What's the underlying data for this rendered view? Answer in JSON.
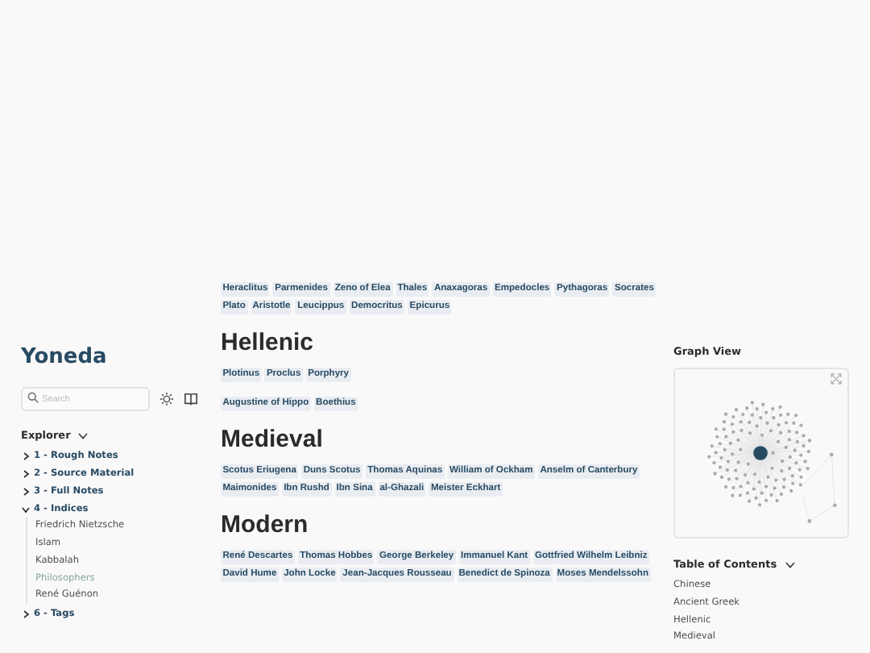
{
  "site_title": "Yoneda",
  "search": {
    "placeholder": "Search"
  },
  "explorer": {
    "title": "Explorer",
    "expanded": true,
    "items": [
      {
        "label": "1 - Rough Notes",
        "expanded": false
      },
      {
        "label": "2 - Source Material",
        "expanded": false
      },
      {
        "label": "3 - Full Notes",
        "expanded": false
      },
      {
        "label": "4 - Indices",
        "expanded": true,
        "children": [
          {
            "label": "Friedrich Nietzsche",
            "selected": false
          },
          {
            "label": "Islam",
            "selected": false
          },
          {
            "label": "Kabbalah",
            "selected": false
          },
          {
            "label": "Philosophers",
            "selected": true
          },
          {
            "label": "René Guénon",
            "selected": false
          }
        ]
      },
      {
        "label": "6 - Tags",
        "expanded": false
      }
    ]
  },
  "sections": [
    {
      "tag_groups": [
        [
          "Heraclitus",
          "Parmenides",
          "Zeno of Elea",
          "Thales",
          "Anaxagoras",
          "Empedocles",
          "Pythagoras",
          "Socrates",
          "Plato",
          "Aristotle",
          "Leucippus",
          "Democritus",
          "Epicurus"
        ]
      ]
    },
    {
      "heading": "Hellenic",
      "tag_groups": [
        [
          "Plotinus",
          "Proclus",
          "Porphyry"
        ],
        [
          "Augustine of Hippo",
          "Boethius"
        ]
      ]
    },
    {
      "heading": "Medieval",
      "tag_groups": [
        [
          "Scotus Eriugena",
          "Duns Scotus",
          "Thomas Aquinas",
          "William of Ockham",
          "Anselm of Canterbury",
          "Maimonides",
          "Ibn Rushd",
          "Ibn Sina",
          "al-Ghazali",
          "Meister Eckhart"
        ]
      ]
    },
    {
      "heading": "Modern",
      "tag_groups": [
        [
          "René Descartes",
          "Thomas Hobbes",
          "George Berkeley",
          "Immanuel Kant",
          "Gottfried Wilhelm Leibniz",
          "David Hume",
          "John Locke",
          "Jean-Jacques Rousseau",
          "Benedict de Spinoza",
          "Moses Mendelssohn"
        ]
      ]
    }
  ],
  "graph_view": {
    "title": "Graph View"
  },
  "toc": {
    "title": "Table of Contents",
    "expanded": true,
    "items": [
      "Chinese",
      "Ancient Greek",
      "Hellenic",
      "Medieval"
    ]
  }
}
